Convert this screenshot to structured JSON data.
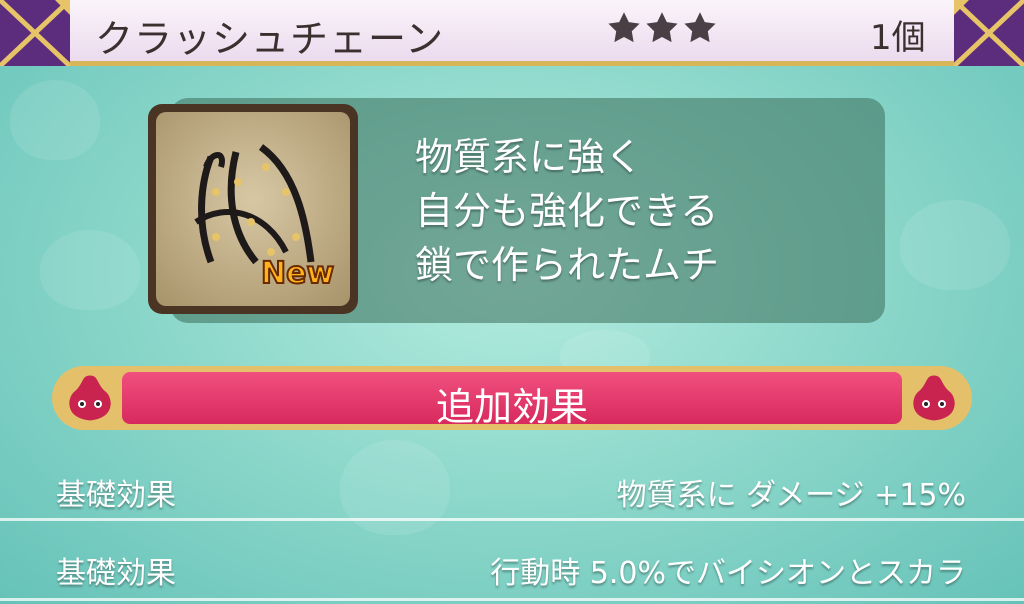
{
  "header": {
    "item_name": "クラッシュチェーン",
    "count": "1個",
    "rarity_stars": 3,
    "star_color": "#4a3f45"
  },
  "item": {
    "icon": "chain-whip-icon",
    "badge": "New",
    "description_lines": [
      "物質系に強く",
      "自分も強化できる",
      "鎖で作られたムチ"
    ]
  },
  "effects_banner": {
    "label": "追加効果",
    "color": "#e23a6a"
  },
  "effects": [
    {
      "label": "基礎効果",
      "value": "物質系に ダメージ +15%"
    },
    {
      "label": "基礎効果",
      "value": "行動時 5.0%でバイシオンとスカラ"
    }
  ]
}
